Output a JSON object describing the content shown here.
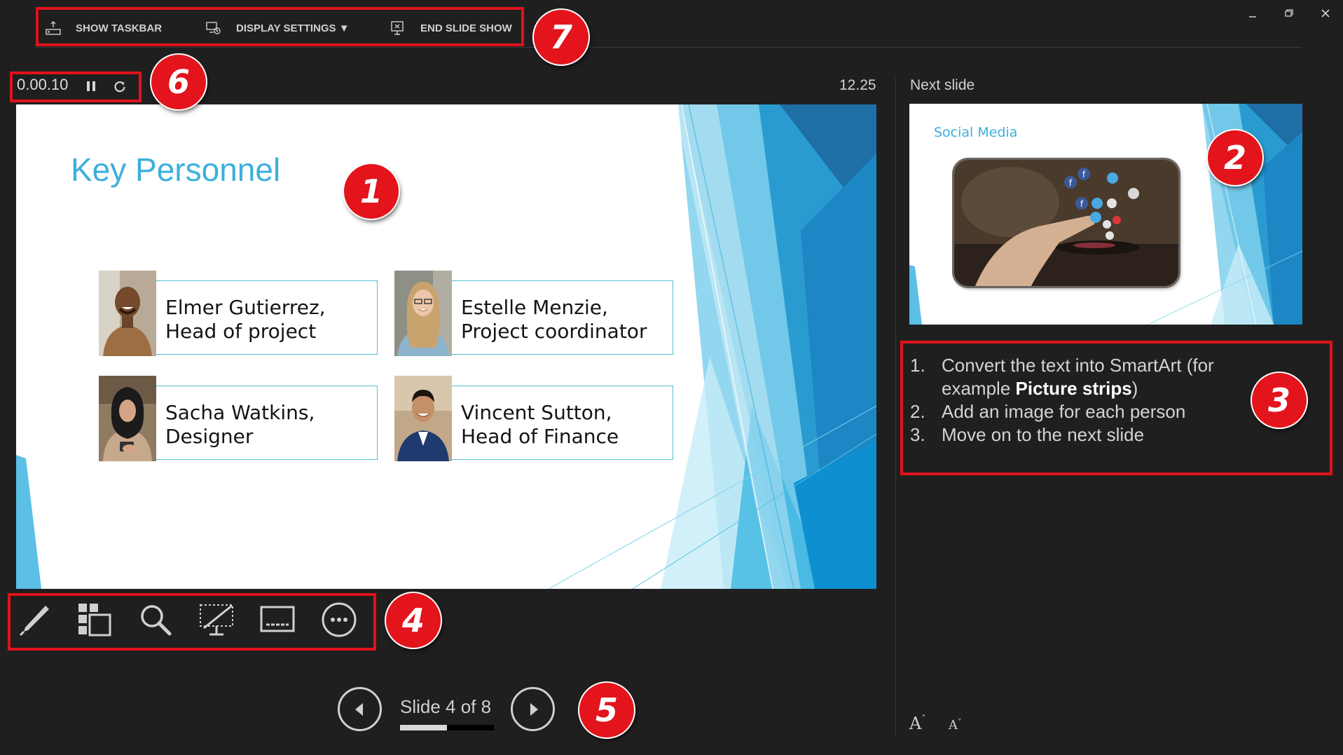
{
  "toolbar": {
    "show_taskbar": "SHOW TASKBAR",
    "display_settings": "DISPLAY SETTINGS ▼",
    "end_slide_show": "END SLIDE SHOW"
  },
  "window_controls": [
    "minimize-icon",
    "restore-icon",
    "close-icon"
  ],
  "timer": {
    "elapsed": "0.00.10",
    "pause_icon": "pause-icon",
    "restart_icon": "restart-icon"
  },
  "clock": "12.25",
  "current_slide": {
    "title": "Key Personnel",
    "people": [
      {
        "line1": "Elmer Gutierrez,",
        "line2": "Head of project"
      },
      {
        "line1": "Estelle Menzie,",
        "line2": "Project coordinator"
      },
      {
        "line1": "Sacha Watkins,",
        "line2": "Designer"
      },
      {
        "line1": "Vincent Sutton,",
        "line2": "Head of Finance"
      }
    ]
  },
  "next_slide": {
    "label": "Next slide",
    "title": "Social Media"
  },
  "notes": {
    "item1_num": "1.",
    "item1_text_a": "Convert the text into SmartArt (for",
    "item1_text_b": "example ",
    "item1_bold": "Picture strips",
    "item1_text_c": ")",
    "item2_num": "2.",
    "item2_text": "Add an image for each person",
    "item3_num": "3.",
    "item3_text": "Move on to the next slide"
  },
  "font_controls": {
    "increase": "A",
    "decrease": "A"
  },
  "tools": [
    "pen-icon",
    "slides-grid-icon",
    "zoom-icon",
    "black-screen-icon",
    "subtitles-icon",
    "more-options-icon"
  ],
  "navigation": {
    "slide_counter": "Slide 4 of 8",
    "progress_fraction": 0.5
  },
  "markers": [
    "1",
    "2",
    "3",
    "4",
    "5",
    "6",
    "7"
  ],
  "colors": {
    "accent": "#3cb0dc",
    "annotation_red": "#e0121b",
    "background": "#1f1f1f"
  }
}
